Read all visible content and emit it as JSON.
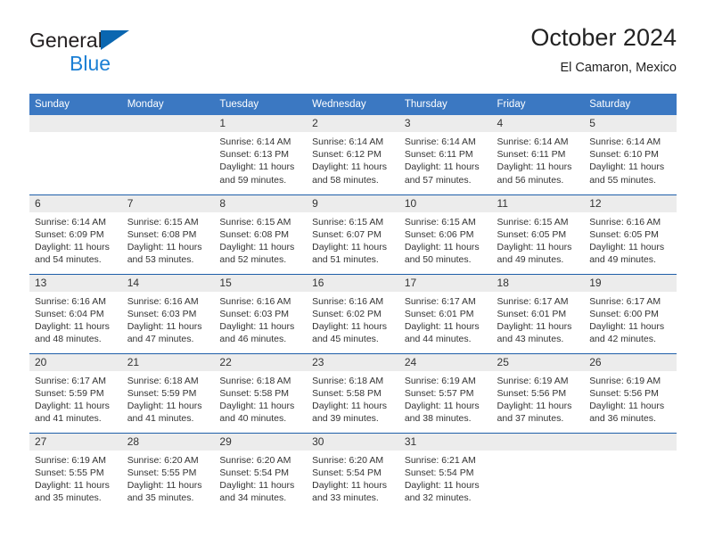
{
  "brand": {
    "line1": "General",
    "line2": "Blue",
    "logo_icon": "triangle-flag-icon",
    "accent_color": "#1b7fd4"
  },
  "header": {
    "title": "October 2024",
    "subtitle": "El Camaron, Mexico"
  },
  "colors": {
    "header_blue": "#3b78c2",
    "row_rule": "#1f5fa9",
    "daynum_band": "#ececec",
    "text": "#333333"
  },
  "weekday_headers": [
    "Sunday",
    "Monday",
    "Tuesday",
    "Wednesday",
    "Thursday",
    "Friday",
    "Saturday"
  ],
  "weeks": [
    [
      {
        "day": "",
        "empty": true,
        "sunrise": "",
        "sunset": "",
        "daylight_line1": "",
        "daylight_line2": ""
      },
      {
        "day": "",
        "empty": true,
        "sunrise": "",
        "sunset": "",
        "daylight_line1": "",
        "daylight_line2": ""
      },
      {
        "day": "1",
        "sunrise": "Sunrise: 6:14 AM",
        "sunset": "Sunset: 6:13 PM",
        "daylight_line1": "Daylight: 11 hours",
        "daylight_line2": "and 59 minutes."
      },
      {
        "day": "2",
        "sunrise": "Sunrise: 6:14 AM",
        "sunset": "Sunset: 6:12 PM",
        "daylight_line1": "Daylight: 11 hours",
        "daylight_line2": "and 58 minutes."
      },
      {
        "day": "3",
        "sunrise": "Sunrise: 6:14 AM",
        "sunset": "Sunset: 6:11 PM",
        "daylight_line1": "Daylight: 11 hours",
        "daylight_line2": "and 57 minutes."
      },
      {
        "day": "4",
        "sunrise": "Sunrise: 6:14 AM",
        "sunset": "Sunset: 6:11 PM",
        "daylight_line1": "Daylight: 11 hours",
        "daylight_line2": "and 56 minutes."
      },
      {
        "day": "5",
        "sunrise": "Sunrise: 6:14 AM",
        "sunset": "Sunset: 6:10 PM",
        "daylight_line1": "Daylight: 11 hours",
        "daylight_line2": "and 55 minutes."
      }
    ],
    [
      {
        "day": "6",
        "sunrise": "Sunrise: 6:14 AM",
        "sunset": "Sunset: 6:09 PM",
        "daylight_line1": "Daylight: 11 hours",
        "daylight_line2": "and 54 minutes."
      },
      {
        "day": "7",
        "sunrise": "Sunrise: 6:15 AM",
        "sunset": "Sunset: 6:08 PM",
        "daylight_line1": "Daylight: 11 hours",
        "daylight_line2": "and 53 minutes."
      },
      {
        "day": "8",
        "sunrise": "Sunrise: 6:15 AM",
        "sunset": "Sunset: 6:08 PM",
        "daylight_line1": "Daylight: 11 hours",
        "daylight_line2": "and 52 minutes."
      },
      {
        "day": "9",
        "sunrise": "Sunrise: 6:15 AM",
        "sunset": "Sunset: 6:07 PM",
        "daylight_line1": "Daylight: 11 hours",
        "daylight_line2": "and 51 minutes."
      },
      {
        "day": "10",
        "sunrise": "Sunrise: 6:15 AM",
        "sunset": "Sunset: 6:06 PM",
        "daylight_line1": "Daylight: 11 hours",
        "daylight_line2": "and 50 minutes."
      },
      {
        "day": "11",
        "sunrise": "Sunrise: 6:15 AM",
        "sunset": "Sunset: 6:05 PM",
        "daylight_line1": "Daylight: 11 hours",
        "daylight_line2": "and 49 minutes."
      },
      {
        "day": "12",
        "sunrise": "Sunrise: 6:16 AM",
        "sunset": "Sunset: 6:05 PM",
        "daylight_line1": "Daylight: 11 hours",
        "daylight_line2": "and 49 minutes."
      }
    ],
    [
      {
        "day": "13",
        "sunrise": "Sunrise: 6:16 AM",
        "sunset": "Sunset: 6:04 PM",
        "daylight_line1": "Daylight: 11 hours",
        "daylight_line2": "and 48 minutes."
      },
      {
        "day": "14",
        "sunrise": "Sunrise: 6:16 AM",
        "sunset": "Sunset: 6:03 PM",
        "daylight_line1": "Daylight: 11 hours",
        "daylight_line2": "and 47 minutes."
      },
      {
        "day": "15",
        "sunrise": "Sunrise: 6:16 AM",
        "sunset": "Sunset: 6:03 PM",
        "daylight_line1": "Daylight: 11 hours",
        "daylight_line2": "and 46 minutes."
      },
      {
        "day": "16",
        "sunrise": "Sunrise: 6:16 AM",
        "sunset": "Sunset: 6:02 PM",
        "daylight_line1": "Daylight: 11 hours",
        "daylight_line2": "and 45 minutes."
      },
      {
        "day": "17",
        "sunrise": "Sunrise: 6:17 AM",
        "sunset": "Sunset: 6:01 PM",
        "daylight_line1": "Daylight: 11 hours",
        "daylight_line2": "and 44 minutes."
      },
      {
        "day": "18",
        "sunrise": "Sunrise: 6:17 AM",
        "sunset": "Sunset: 6:01 PM",
        "daylight_line1": "Daylight: 11 hours",
        "daylight_line2": "and 43 minutes."
      },
      {
        "day": "19",
        "sunrise": "Sunrise: 6:17 AM",
        "sunset": "Sunset: 6:00 PM",
        "daylight_line1": "Daylight: 11 hours",
        "daylight_line2": "and 42 minutes."
      }
    ],
    [
      {
        "day": "20",
        "sunrise": "Sunrise: 6:17 AM",
        "sunset": "Sunset: 5:59 PM",
        "daylight_line1": "Daylight: 11 hours",
        "daylight_line2": "and 41 minutes."
      },
      {
        "day": "21",
        "sunrise": "Sunrise: 6:18 AM",
        "sunset": "Sunset: 5:59 PM",
        "daylight_line1": "Daylight: 11 hours",
        "daylight_line2": "and 41 minutes."
      },
      {
        "day": "22",
        "sunrise": "Sunrise: 6:18 AM",
        "sunset": "Sunset: 5:58 PM",
        "daylight_line1": "Daylight: 11 hours",
        "daylight_line2": "and 40 minutes."
      },
      {
        "day": "23",
        "sunrise": "Sunrise: 6:18 AM",
        "sunset": "Sunset: 5:58 PM",
        "daylight_line1": "Daylight: 11 hours",
        "daylight_line2": "and 39 minutes."
      },
      {
        "day": "24",
        "sunrise": "Sunrise: 6:19 AM",
        "sunset": "Sunset: 5:57 PM",
        "daylight_line1": "Daylight: 11 hours",
        "daylight_line2": "and 38 minutes."
      },
      {
        "day": "25",
        "sunrise": "Sunrise: 6:19 AM",
        "sunset": "Sunset: 5:56 PM",
        "daylight_line1": "Daylight: 11 hours",
        "daylight_line2": "and 37 minutes."
      },
      {
        "day": "26",
        "sunrise": "Sunrise: 6:19 AM",
        "sunset": "Sunset: 5:56 PM",
        "daylight_line1": "Daylight: 11 hours",
        "daylight_line2": "and 36 minutes."
      }
    ],
    [
      {
        "day": "27",
        "sunrise": "Sunrise: 6:19 AM",
        "sunset": "Sunset: 5:55 PM",
        "daylight_line1": "Daylight: 11 hours",
        "daylight_line2": "and 35 minutes."
      },
      {
        "day": "28",
        "sunrise": "Sunrise: 6:20 AM",
        "sunset": "Sunset: 5:55 PM",
        "daylight_line1": "Daylight: 11 hours",
        "daylight_line2": "and 35 minutes."
      },
      {
        "day": "29",
        "sunrise": "Sunrise: 6:20 AM",
        "sunset": "Sunset: 5:54 PM",
        "daylight_line1": "Daylight: 11 hours",
        "daylight_line2": "and 34 minutes."
      },
      {
        "day": "30",
        "sunrise": "Sunrise: 6:20 AM",
        "sunset": "Sunset: 5:54 PM",
        "daylight_line1": "Daylight: 11 hours",
        "daylight_line2": "and 33 minutes."
      },
      {
        "day": "31",
        "sunrise": "Sunrise: 6:21 AM",
        "sunset": "Sunset: 5:54 PM",
        "daylight_line1": "Daylight: 11 hours",
        "daylight_line2": "and 32 minutes."
      },
      {
        "day": "",
        "empty": true,
        "sunrise": "",
        "sunset": "",
        "daylight_line1": "",
        "daylight_line2": ""
      },
      {
        "day": "",
        "empty": true,
        "sunrise": "",
        "sunset": "",
        "daylight_line1": "",
        "daylight_line2": ""
      }
    ]
  ]
}
